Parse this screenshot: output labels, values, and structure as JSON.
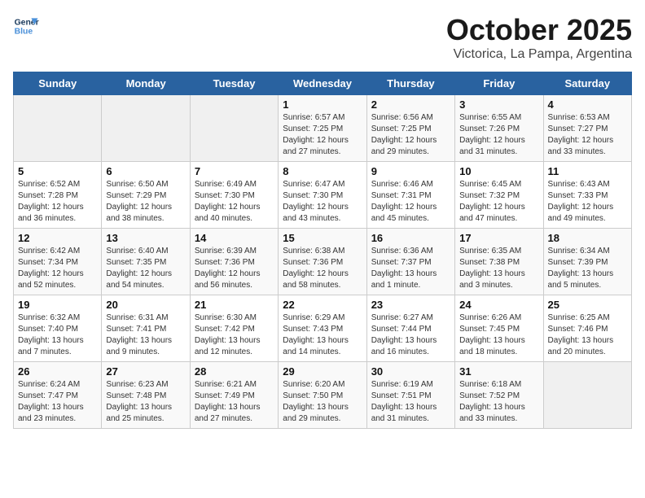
{
  "logo": {
    "line1": "General",
    "line2": "Blue"
  },
  "title": "October 2025",
  "subtitle": "Victorica, La Pampa, Argentina",
  "days_of_week": [
    "Sunday",
    "Monday",
    "Tuesday",
    "Wednesday",
    "Thursday",
    "Friday",
    "Saturday"
  ],
  "weeks": [
    [
      {
        "day": "",
        "info": ""
      },
      {
        "day": "",
        "info": ""
      },
      {
        "day": "",
        "info": ""
      },
      {
        "day": "1",
        "info": "Sunrise: 6:57 AM\nSunset: 7:25 PM\nDaylight: 12 hours\nand 27 minutes."
      },
      {
        "day": "2",
        "info": "Sunrise: 6:56 AM\nSunset: 7:25 PM\nDaylight: 12 hours\nand 29 minutes."
      },
      {
        "day": "3",
        "info": "Sunrise: 6:55 AM\nSunset: 7:26 PM\nDaylight: 12 hours\nand 31 minutes."
      },
      {
        "day": "4",
        "info": "Sunrise: 6:53 AM\nSunset: 7:27 PM\nDaylight: 12 hours\nand 33 minutes."
      }
    ],
    [
      {
        "day": "5",
        "info": "Sunrise: 6:52 AM\nSunset: 7:28 PM\nDaylight: 12 hours\nand 36 minutes."
      },
      {
        "day": "6",
        "info": "Sunrise: 6:50 AM\nSunset: 7:29 PM\nDaylight: 12 hours\nand 38 minutes."
      },
      {
        "day": "7",
        "info": "Sunrise: 6:49 AM\nSunset: 7:30 PM\nDaylight: 12 hours\nand 40 minutes."
      },
      {
        "day": "8",
        "info": "Sunrise: 6:47 AM\nSunset: 7:30 PM\nDaylight: 12 hours\nand 43 minutes."
      },
      {
        "day": "9",
        "info": "Sunrise: 6:46 AM\nSunset: 7:31 PM\nDaylight: 12 hours\nand 45 minutes."
      },
      {
        "day": "10",
        "info": "Sunrise: 6:45 AM\nSunset: 7:32 PM\nDaylight: 12 hours\nand 47 minutes."
      },
      {
        "day": "11",
        "info": "Sunrise: 6:43 AM\nSunset: 7:33 PM\nDaylight: 12 hours\nand 49 minutes."
      }
    ],
    [
      {
        "day": "12",
        "info": "Sunrise: 6:42 AM\nSunset: 7:34 PM\nDaylight: 12 hours\nand 52 minutes."
      },
      {
        "day": "13",
        "info": "Sunrise: 6:40 AM\nSunset: 7:35 PM\nDaylight: 12 hours\nand 54 minutes."
      },
      {
        "day": "14",
        "info": "Sunrise: 6:39 AM\nSunset: 7:36 PM\nDaylight: 12 hours\nand 56 minutes."
      },
      {
        "day": "15",
        "info": "Sunrise: 6:38 AM\nSunset: 7:36 PM\nDaylight: 12 hours\nand 58 minutes."
      },
      {
        "day": "16",
        "info": "Sunrise: 6:36 AM\nSunset: 7:37 PM\nDaylight: 13 hours\nand 1 minute."
      },
      {
        "day": "17",
        "info": "Sunrise: 6:35 AM\nSunset: 7:38 PM\nDaylight: 13 hours\nand 3 minutes."
      },
      {
        "day": "18",
        "info": "Sunrise: 6:34 AM\nSunset: 7:39 PM\nDaylight: 13 hours\nand 5 minutes."
      }
    ],
    [
      {
        "day": "19",
        "info": "Sunrise: 6:32 AM\nSunset: 7:40 PM\nDaylight: 13 hours\nand 7 minutes."
      },
      {
        "day": "20",
        "info": "Sunrise: 6:31 AM\nSunset: 7:41 PM\nDaylight: 13 hours\nand 9 minutes."
      },
      {
        "day": "21",
        "info": "Sunrise: 6:30 AM\nSunset: 7:42 PM\nDaylight: 13 hours\nand 12 minutes."
      },
      {
        "day": "22",
        "info": "Sunrise: 6:29 AM\nSunset: 7:43 PM\nDaylight: 13 hours\nand 14 minutes."
      },
      {
        "day": "23",
        "info": "Sunrise: 6:27 AM\nSunset: 7:44 PM\nDaylight: 13 hours\nand 16 minutes."
      },
      {
        "day": "24",
        "info": "Sunrise: 6:26 AM\nSunset: 7:45 PM\nDaylight: 13 hours\nand 18 minutes."
      },
      {
        "day": "25",
        "info": "Sunrise: 6:25 AM\nSunset: 7:46 PM\nDaylight: 13 hours\nand 20 minutes."
      }
    ],
    [
      {
        "day": "26",
        "info": "Sunrise: 6:24 AM\nSunset: 7:47 PM\nDaylight: 13 hours\nand 23 minutes."
      },
      {
        "day": "27",
        "info": "Sunrise: 6:23 AM\nSunset: 7:48 PM\nDaylight: 13 hours\nand 25 minutes."
      },
      {
        "day": "28",
        "info": "Sunrise: 6:21 AM\nSunset: 7:49 PM\nDaylight: 13 hours\nand 27 minutes."
      },
      {
        "day": "29",
        "info": "Sunrise: 6:20 AM\nSunset: 7:50 PM\nDaylight: 13 hours\nand 29 minutes."
      },
      {
        "day": "30",
        "info": "Sunrise: 6:19 AM\nSunset: 7:51 PM\nDaylight: 13 hours\nand 31 minutes."
      },
      {
        "day": "31",
        "info": "Sunrise: 6:18 AM\nSunset: 7:52 PM\nDaylight: 13 hours\nand 33 minutes."
      },
      {
        "day": "",
        "info": ""
      }
    ]
  ]
}
